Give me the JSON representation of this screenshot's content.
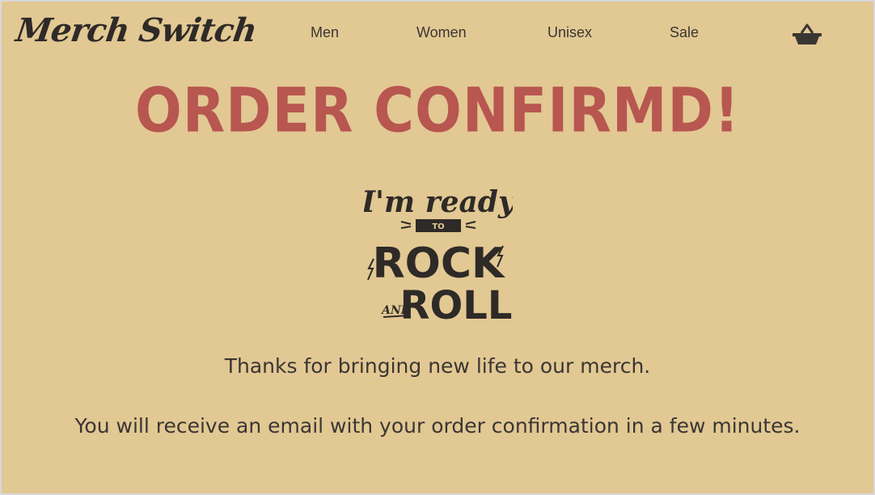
{
  "header": {
    "logo_text": "Merch Switch",
    "nav": [
      {
        "label": "Men"
      },
      {
        "label": "Women"
      },
      {
        "label": "Unisex"
      },
      {
        "label": "Sale"
      }
    ],
    "cart_icon": "basket-icon"
  },
  "main": {
    "headline": "ORDER CONFIRMD!",
    "badge": {
      "line1": "I'm ready",
      "line2": "TO",
      "line3": "ROCK",
      "line4a": "AND",
      "line4b": "ROLL"
    },
    "thanks_text": "Thanks for bringing new life to our merch.",
    "email_text": "You will receive an email with your order confirmation in a few minutes."
  },
  "colors": {
    "background": "#e2c893",
    "headline": "#b85650",
    "text": "#3a3633"
  }
}
